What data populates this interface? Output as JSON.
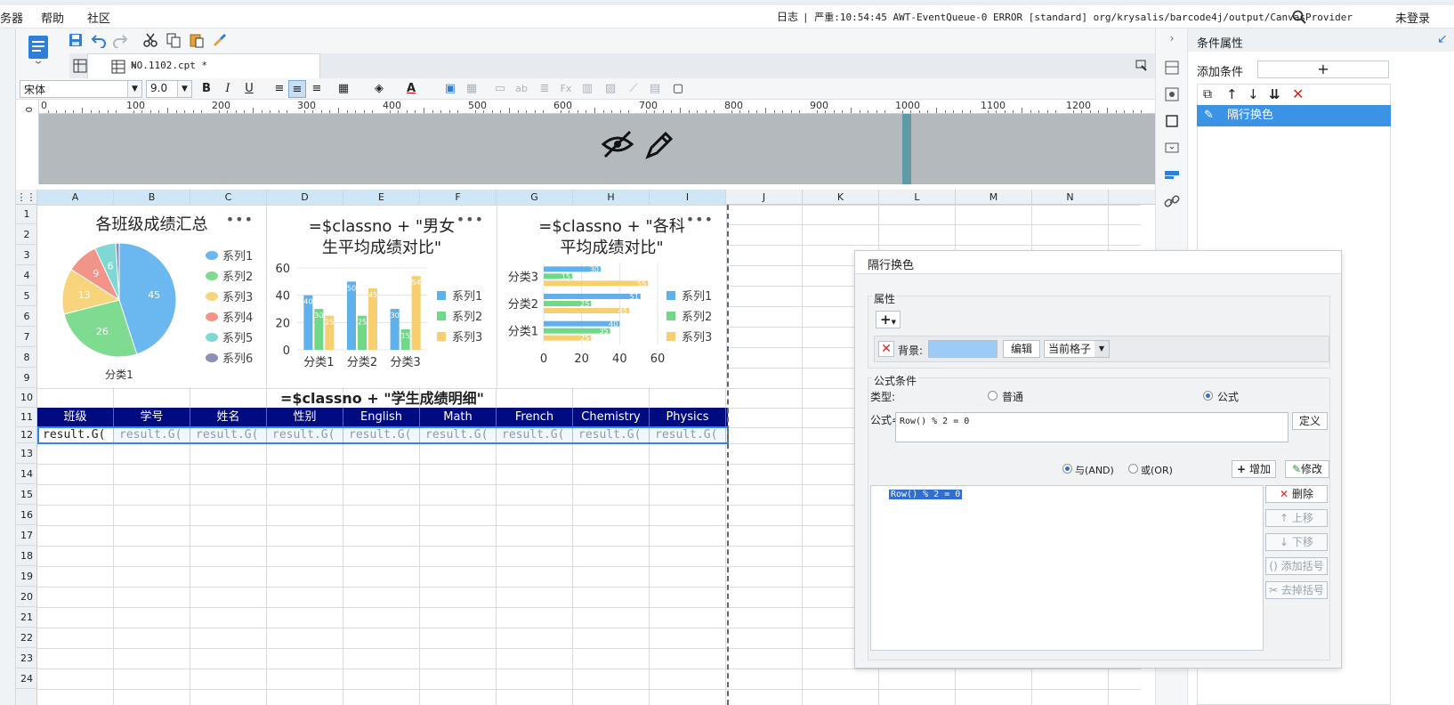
{
  "menubar": {
    "items": [
      "务器",
      "帮助",
      "社区"
    ],
    "log_label": "日志",
    "log_message": "| 严重:10:54:45 AWT-EventQueue-0 ERROR [standard] org/krysalis/barcode4j/output/CanvasProvider",
    "login": "未登录"
  },
  "tab": {
    "label": "NO.1102.cpt *",
    "close": "×"
  },
  "format": {
    "font": "宋体",
    "size": "9.0"
  },
  "ruler": {
    "ticks": [
      "0",
      "100",
      "200",
      "300",
      "400",
      "500",
      "600",
      "700",
      "800",
      "900",
      "1000",
      "1100",
      "1200"
    ]
  },
  "grid": {
    "columns": [
      "A",
      "B",
      "C",
      "D",
      "E",
      "F",
      "G",
      "H",
      "I",
      "J",
      "K",
      "L",
      "M",
      "N"
    ],
    "rows": [
      "1",
      "2",
      "3",
      "4",
      "5",
      "6",
      "7",
      "8",
      "9",
      "10",
      "11",
      "12",
      "13",
      "14",
      "15",
      "16",
      "17",
      "18",
      "19",
      "20",
      "21",
      "22",
      "23",
      "24"
    ]
  },
  "report": {
    "detail_title": "=$classno + \"学生成绩明细\"",
    "headers": [
      "班级",
      "学号",
      "姓名",
      "性别",
      "English",
      "Math",
      "French",
      "Chemistry",
      "Physics"
    ],
    "cells": [
      "result.G(",
      "result.G(",
      "result.G(",
      "result.G(",
      "result.G(",
      "result.G(",
      "result.G(",
      "result.G(",
      "result.G("
    ]
  },
  "chart_data": [
    {
      "type": "pie",
      "title": "各班级成绩汇总",
      "category": "分类1",
      "series": [
        {
          "name": "系列1",
          "value": 45
        },
        {
          "name": "系列2",
          "value": 26
        },
        {
          "name": "系列3",
          "value": 13
        },
        {
          "name": "系列4",
          "value": 9
        },
        {
          "name": "系列5",
          "value": 6
        },
        {
          "name": "系列6",
          "value": 1
        }
      ],
      "colors": [
        "#6bb7f0",
        "#7ddc8f",
        "#f8d47c",
        "#f39489",
        "#7fd8d4",
        "#8e8fb8"
      ]
    },
    {
      "type": "bar",
      "title": "=$classno + \"男女生平均成绩对比\"",
      "categories": [
        "分类1",
        "分类2",
        "分类3"
      ],
      "series": [
        {
          "name": "系列1",
          "values": [
            40,
            50,
            30
          ]
        },
        {
          "name": "系列2",
          "values": [
            30,
            25,
            15
          ]
        },
        {
          "name": "系列3",
          "values": [
            25,
            45,
            54
          ]
        }
      ],
      "ylim": [
        0,
        60
      ],
      "yticks": [
        "0",
        "20",
        "40",
        "60"
      ],
      "colors": [
        "#5fb1ee",
        "#70d987",
        "#f8cf6e"
      ]
    },
    {
      "type": "bar",
      "orientation": "horizontal",
      "title": "=$classno + \"各科平均成绩对比\"",
      "categories": [
        "分类1",
        "分类2",
        "分类3"
      ],
      "series": [
        {
          "name": "系列1",
          "values": [
            40,
            51,
            30
          ]
        },
        {
          "name": "系列2",
          "values": [
            35,
            25,
            15
          ]
        },
        {
          "name": "系列3",
          "values": [
            25,
            45,
            55
          ]
        }
      ],
      "xlim": [
        0,
        60
      ],
      "xticks": [
        "0",
        "20",
        "40",
        "60"
      ],
      "colors": [
        "#5fb1ee",
        "#70d987",
        "#f8cf6e"
      ]
    }
  ],
  "cond_panel": {
    "title": "条件属性",
    "add_label": "添加条件",
    "add_symbol": "+",
    "selected": "隔行换色"
  },
  "dialog": {
    "title": "隔行换色",
    "attr_label": "属性",
    "add_attr": "+",
    "bg_label": "背景:",
    "bg_color": "#9ccbf8",
    "edit": "编辑",
    "scope": "当前格子",
    "formula_section": "公式条件",
    "type_label": "类型:",
    "type_normal": "普通",
    "type_formula": "公式",
    "formula_label": "公式=",
    "formula_value": "Row() % 2 = 0",
    "define": "定义",
    "and_label": "与(AND)",
    "or_label": "或(OR)",
    "add_btn": "增加",
    "modify_btn": "修改",
    "list_item": "Row() % 2 = 0",
    "delete": "删除",
    "up": "上移",
    "down": "下移",
    "add_bracket": "添加括号",
    "remove_bracket": "去掉括号"
  }
}
